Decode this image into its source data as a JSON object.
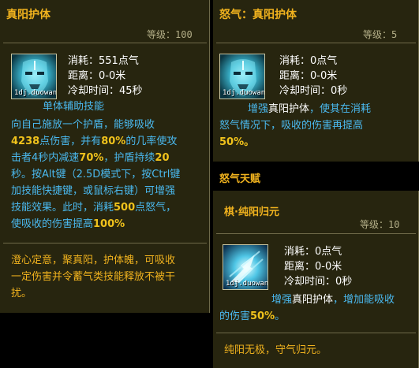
{
  "left": {
    "title": "真阳护体",
    "level": "等级：100",
    "icon": {
      "name": "glowing-mask-icon",
      "caption": "1dj.duowan"
    },
    "stats": [
      {
        "label": "消耗：",
        "value": "551点气"
      },
      {
        "label": "距离：",
        "value": "0-0米"
      },
      {
        "label": "冷却时间：",
        "value": "45秒"
      }
    ],
    "skill_type": "单体辅助技能",
    "desc": {
      "l1": "向自己施放一个护盾，能够吸收",
      "l2a": "4238",
      "l2b": "点伤害，并有",
      "l2c": "80%",
      "l2d": "的几率使攻",
      "l3a": "击者4秒内减速",
      "l3b": "70%",
      "l3c": "，护盾持续",
      "l3d": "20",
      "l4": "秒。按Alt键（2.5D模式下，按Ctrl键",
      "l5": "加技能快捷键，或鼠标右键）可增强",
      "l6a": "技能效果。此时，消耗",
      "l6b": "500",
      "l6c": "点怒气，",
      "l7a": "使吸收的伤害提高",
      "l7b": "100%"
    },
    "flavor": [
      "澄心定意，聚真阳，护体魄，可吸收",
      "一定伤害并令蓄气类技能释放不被干",
      "扰。"
    ]
  },
  "right_top": {
    "title": "怒气：真阳护体",
    "level": "等级：5",
    "icon": {
      "name": "glowing-mask-icon",
      "caption": "1dj.duowan"
    },
    "stats": [
      {
        "label": "消耗：",
        "value": "0点气"
      },
      {
        "label": "距离：",
        "value": "0-0米"
      },
      {
        "label": "冷却时间：",
        "value": "0秒"
      }
    ],
    "desc": {
      "l1a": "增强",
      "l1b": "真阳护体",
      "l1c": "，使其在消耗",
      "l2": "怒气情况下，吸收的伤害再提高",
      "l3": "50%。"
    }
  },
  "talent_heading": "怒气天赋",
  "right_bottom": {
    "title": "棋·纯阳归元",
    "level": "等级：10",
    "icon": {
      "name": "glowing-hand-icon",
      "caption": "1dj.duowan"
    },
    "stats": [
      {
        "label": "消耗：",
        "value": "0点气"
      },
      {
        "label": "距离：",
        "value": "0-0米"
      },
      {
        "label": "冷却时间：",
        "value": "0秒"
      }
    ],
    "desc": {
      "l1a": "增强",
      "l1b": "真阳护体",
      "l1c": "，增加能吸收",
      "l2a": "的伤害",
      "l2b": "50%",
      "l2c": "。"
    },
    "flavor": "纯阳无极，守气归元。"
  }
}
